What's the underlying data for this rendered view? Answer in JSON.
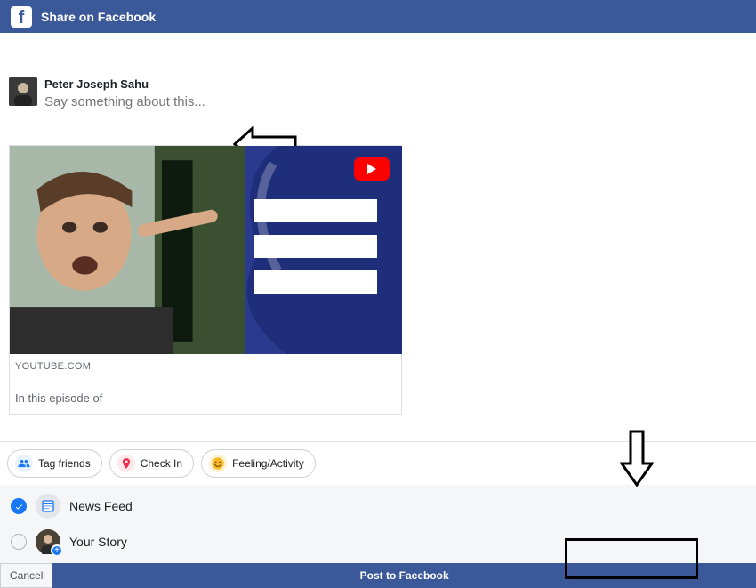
{
  "topbar": {
    "title": "Share on Facebook"
  },
  "composer": {
    "author_name": "Peter Joseph Sahu",
    "placeholder": "Say something about this..."
  },
  "preview": {
    "domain": "YOUTUBE.COM",
    "title_redacted": "",
    "description_prefix": "In this episode of "
  },
  "pills": {
    "tag_friends": "Tag friends",
    "check_in": "Check In",
    "feeling_activity": "Feeling/Activity"
  },
  "destinations": {
    "news_feed": "News Feed",
    "your_story": "Your Story"
  },
  "actions": {
    "cancel": "Cancel",
    "post": "Post to Facebook"
  }
}
